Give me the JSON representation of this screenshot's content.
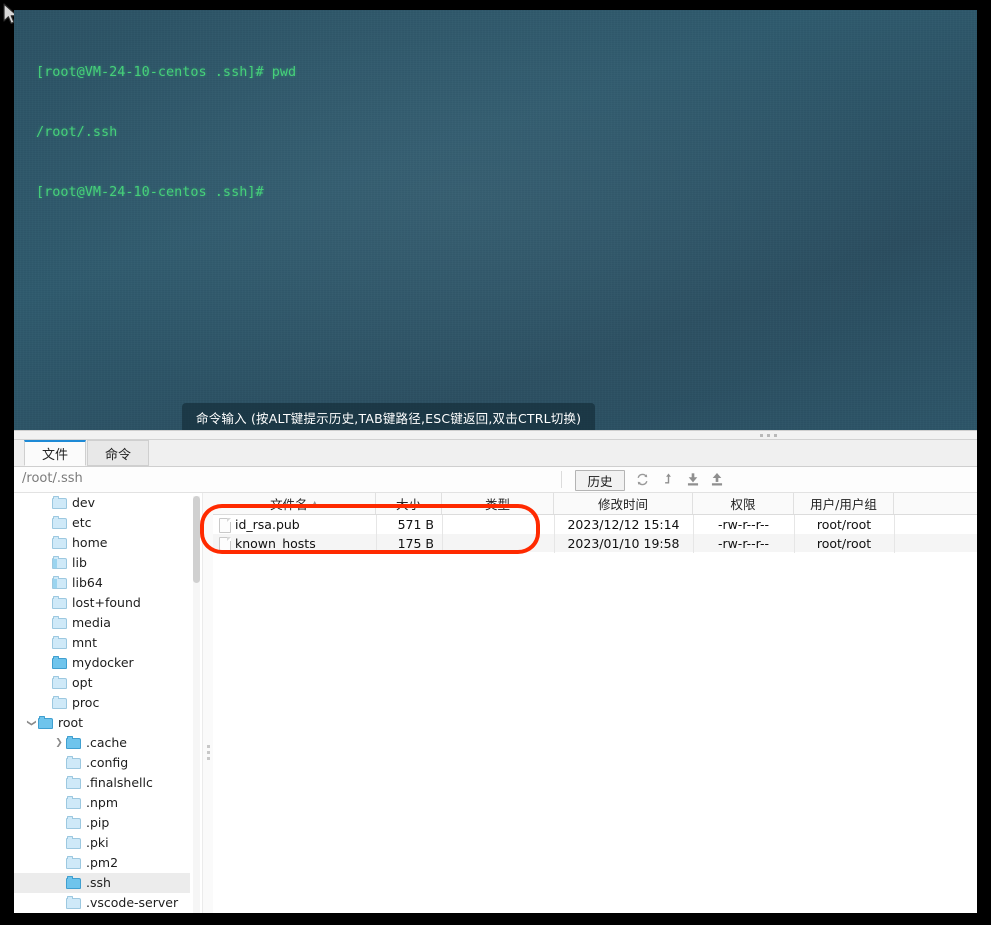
{
  "terminal": {
    "lines": [
      "[root@VM-24-10-centos .ssh]# pwd",
      "/root/.ssh",
      "[root@VM-24-10-centos .ssh]#"
    ],
    "prompt_color": "#46d07a",
    "background_color": "#2e5668",
    "hint": "命令输入 (按ALT键提示历史,TAB键路径,ESC键返回,双击CTRL切换)"
  },
  "tabs": [
    {
      "label": "文件",
      "active": true
    },
    {
      "label": "命令",
      "active": false
    }
  ],
  "toolbar": {
    "path": "/root/.ssh",
    "history_label": "历史",
    "icons": [
      {
        "name": "refresh-icon"
      },
      {
        "name": "go-up-icon"
      },
      {
        "name": "download-icon"
      },
      {
        "name": "upload-icon"
      }
    ]
  },
  "tree": {
    "items": [
      {
        "label": "dev",
        "indent": 1,
        "expander": "none",
        "folder": "closed"
      },
      {
        "label": "etc",
        "indent": 1,
        "expander": "none",
        "folder": "closed"
      },
      {
        "label": "home",
        "indent": 1,
        "expander": "none",
        "folder": "closed"
      },
      {
        "label": "lib",
        "indent": 1,
        "expander": "none",
        "folder": "link"
      },
      {
        "label": "lib64",
        "indent": 1,
        "expander": "none",
        "folder": "link"
      },
      {
        "label": "lost+found",
        "indent": 1,
        "expander": "none",
        "folder": "closed"
      },
      {
        "label": "media",
        "indent": 1,
        "expander": "none",
        "folder": "closed"
      },
      {
        "label": "mnt",
        "indent": 1,
        "expander": "none",
        "folder": "closed"
      },
      {
        "label": "mydocker",
        "indent": 1,
        "expander": "none",
        "folder": "open"
      },
      {
        "label": "opt",
        "indent": 1,
        "expander": "none",
        "folder": "closed"
      },
      {
        "label": "proc",
        "indent": 1,
        "expander": "none",
        "folder": "closed"
      },
      {
        "label": "root",
        "indent": 0,
        "expander": "expanded",
        "folder": "open"
      },
      {
        "label": ".cache",
        "indent": 2,
        "expander": "collapsed",
        "folder": "open"
      },
      {
        "label": ".config",
        "indent": 2,
        "expander": "none",
        "folder": "closed"
      },
      {
        "label": ".finalshellc",
        "indent": 2,
        "expander": "none",
        "folder": "closed"
      },
      {
        "label": ".npm",
        "indent": 2,
        "expander": "none",
        "folder": "closed"
      },
      {
        "label": ".pip",
        "indent": 2,
        "expander": "none",
        "folder": "closed"
      },
      {
        "label": ".pki",
        "indent": 2,
        "expander": "none",
        "folder": "closed"
      },
      {
        "label": ".pm2",
        "indent": 2,
        "expander": "none",
        "folder": "closed"
      },
      {
        "label": ".ssh",
        "indent": 2,
        "expander": "none",
        "folder": "open",
        "selected": true
      },
      {
        "label": ".vscode-server",
        "indent": 2,
        "expander": "none",
        "folder": "closed"
      }
    ]
  },
  "table": {
    "columns": [
      {
        "label": "文件名",
        "sorted": true
      },
      {
        "label": "大小"
      },
      {
        "label": "类型"
      },
      {
        "label": "修改时间"
      },
      {
        "label": "权限"
      },
      {
        "label": "用户/用户组"
      }
    ],
    "rows": [
      {
        "name": "id_rsa.pub",
        "size": "571 B",
        "type": "",
        "mtime": "2023/12/12 15:14",
        "perm": "-rw-r--r--",
        "owner": "root/root"
      },
      {
        "name": "known_hosts",
        "size": "175 B",
        "type": "",
        "mtime": "2023/01/10 19:58",
        "perm": "-rw-r--r--",
        "owner": "root/root"
      }
    ]
  },
  "annotation": {
    "color": "#ff2a00",
    "shape": "rounded-rectangle",
    "target": "id_rsa.pub row"
  }
}
